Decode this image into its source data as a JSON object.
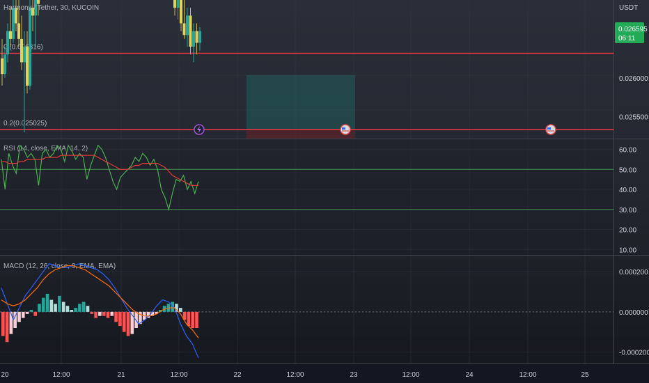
{
  "chart_data": [
    {
      "type": "candlestick",
      "title": "Harmony / Tether, 30, KUCOIN",
      "currency": "USDT",
      "last_price": "0.026595",
      "countdown": "06:11",
      "price_ticks": [
        "0.026000",
        "0.025500"
      ],
      "ylim": [
        0.02522,
        0.027
      ],
      "fib_levels": [
        {
          "label": "0.2(0.025025)",
          "price": 0.025335
        },
        {
          "label": "0.(0.026316)",
          "price": 0.026316
        }
      ],
      "x_labels": [
        "20",
        "12:00",
        "21",
        "12:00",
        "22",
        "12:00",
        "23",
        "12:00",
        "24",
        "12:00",
        "25"
      ],
      "candles": [
        {
          "o": 0.02625,
          "h": 0.0265,
          "l": 0.0259,
          "c": 0.02605
        },
        {
          "o": 0.02605,
          "h": 0.0264,
          "l": 0.026,
          "c": 0.0263
        },
        {
          "o": 0.0263,
          "h": 0.0267,
          "l": 0.0262,
          "c": 0.0266
        },
        {
          "o": 0.0266,
          "h": 0.0269,
          "l": 0.0264,
          "c": 0.0265
        },
        {
          "o": 0.0265,
          "h": 0.027,
          "l": 0.02645,
          "c": 0.0269
        },
        {
          "o": 0.0269,
          "h": 0.027,
          "l": 0.0266,
          "c": 0.0267
        },
        {
          "o": 0.0267,
          "h": 0.027,
          "l": 0.0264,
          "c": 0.0265
        },
        {
          "o": 0.0265,
          "h": 0.0268,
          "l": 0.0261,
          "c": 0.0262
        },
        {
          "o": 0.0262,
          "h": 0.0266,
          "l": 0.0253,
          "c": 0.0264
        },
        {
          "o": 0.0264,
          "h": 0.0266,
          "l": 0.0258,
          "c": 0.0259
        },
        {
          "o": 0.0259,
          "h": 0.027,
          "l": 0.02585,
          "c": 0.0269
        },
        {
          "o": 0.0269,
          "h": 0.027,
          "l": 0.0266,
          "c": 0.0268
        },
        {
          "o": 0.0268,
          "h": 0.027,
          "l": 0.0264,
          "c": 0.027
        },
        {
          "o": 0.027,
          "h": 0.027,
          "l": 0.0268,
          "c": 0.02695
        }
      ],
      "late_candles": [
        {
          "o": 0.027,
          "h": 0.027,
          "l": 0.0268,
          "c": 0.0269
        },
        {
          "o": 0.0269,
          "h": 0.027,
          "l": 0.02675,
          "c": 0.027
        },
        {
          "o": 0.027,
          "h": 0.027,
          "l": 0.0266,
          "c": 0.0267
        },
        {
          "o": 0.0267,
          "h": 0.027,
          "l": 0.0265,
          "c": 0.02655
        },
        {
          "o": 0.02655,
          "h": 0.0269,
          "l": 0.0264,
          "c": 0.0268
        },
        {
          "o": 0.0268,
          "h": 0.0269,
          "l": 0.0263,
          "c": 0.0264
        },
        {
          "o": 0.0264,
          "h": 0.0267,
          "l": 0.0262,
          "c": 0.0266
        },
        {
          "o": 0.0266,
          "h": 0.0267,
          "l": 0.0263,
          "c": 0.02645
        },
        {
          "o": 0.02645,
          "h": 0.02665,
          "l": 0.02635,
          "c": 0.0266
        }
      ],
      "position": {
        "entry": 0.025335,
        "target": 0.026035,
        "stop": 0.02522
      }
    },
    {
      "type": "line",
      "title": "RSI (14, close, EMA, 14, 2)",
      "y_ticks": [
        "60.00",
        "50.00",
        "40.00",
        "30.00",
        "20.00",
        "10.00"
      ],
      "ylim": [
        8,
        64
      ],
      "bands": [
        50,
        30
      ],
      "series": [
        {
          "values": [
            55,
            40,
            58,
            52,
            48,
            62,
            60,
            56,
            58,
            55,
            42,
            58,
            60,
            56,
            58,
            62,
            60,
            54,
            62,
            59,
            55,
            58,
            56,
            45,
            52,
            57,
            62,
            60,
            56,
            50,
            44,
            40,
            46,
            48,
            50,
            52,
            56,
            54,
            58,
            56,
            52,
            55,
            50,
            40,
            36,
            30,
            38,
            45,
            44,
            47,
            40,
            44,
            38,
            44
          ]
        },
        {
          "values": [
            54,
            54,
            53,
            53,
            53,
            54,
            54,
            55,
            55,
            55,
            55,
            55,
            56,
            56,
            56,
            56,
            57,
            57,
            57,
            57,
            57,
            57,
            57,
            57,
            57,
            57,
            56,
            55,
            54,
            53,
            52,
            51,
            50,
            50,
            50,
            51,
            52,
            52,
            53,
            53,
            53,
            53,
            53,
            52,
            51,
            49,
            47,
            46,
            45,
            44,
            43,
            42,
            42,
            42
          ]
        }
      ]
    },
    {
      "type": "bar",
      "title": "MACD (12, 26, close, 9, EMA, EMA)",
      "y_ticks": [
        "0.000200",
        "0.000000",
        "-0.000200"
      ],
      "ylim": [
        -0.00025,
        0.00027
      ],
      "histogram": [
        -0.00012,
        -0.00015,
        -0.00011,
        -8e-05,
        -5e-05,
        -3e-05,
        -1e-05,
        1e-05,
        -2e-05,
        4e-05,
        7e-05,
        9e-05,
        6e-05,
        4e-05,
        8e-05,
        5e-05,
        3e-05,
        1e-05,
        2e-05,
        4e-05,
        5e-05,
        3e-05,
        -1e-05,
        -3e-05,
        -2e-05,
        -2e-05,
        -3e-05,
        -2e-05,
        -5e-05,
        -7e-05,
        -0.0001,
        -0.00012,
        -0.00011,
        -8e-05,
        -6e-05,
        -4e-05,
        -3e-05,
        -2e-05,
        -1e-05,
        1e-05,
        3e-05,
        4e-05,
        5e-05,
        4e-05,
        2e-05,
        -4e-05,
        -7e-05,
        -8e-05,
        -8e-05
      ],
      "series": [
        {
          "values": [
            0.00012,
            4e-05,
            -4e-05,
            2e-05,
            8e-05,
            0.00012,
            0.00016,
            0.0002,
            0.00024,
            0.00023,
            0.00022,
            0.00022,
            0.00023,
            0.00024,
            0.00023,
            0.00022,
            0.00021,
            0.00019,
            0.00016,
            0.00012,
            7e-05,
            2e-05,
            -2e-05,
            -6e-05,
            -4e-05,
            -1e-05,
            3e-05,
            6e-05,
            5e-05,
            2e-05,
            -6e-05,
            -0.00012,
            -0.00016,
            -0.00023
          ]
        },
        {
          "values": [
            6e-05,
            4e-05,
            3e-05,
            4e-05,
            6e-05,
            9e-05,
            0.00012,
            0.00016,
            0.00019,
            0.00021,
            0.00022,
            0.00023,
            0.00023,
            0.00022,
            0.00021,
            0.00019,
            0.00017,
            0.00015,
            0.00013,
            0.0001,
            7e-05,
            4e-05,
            1e-05,
            -1e-05,
            -2e-05,
            -2e-05,
            -1e-05,
            1e-05,
            2e-05,
            2e-05,
            -1e-05,
            -6e-05,
            -9e-05,
            -0.00013
          ]
        }
      ]
    }
  ]
}
